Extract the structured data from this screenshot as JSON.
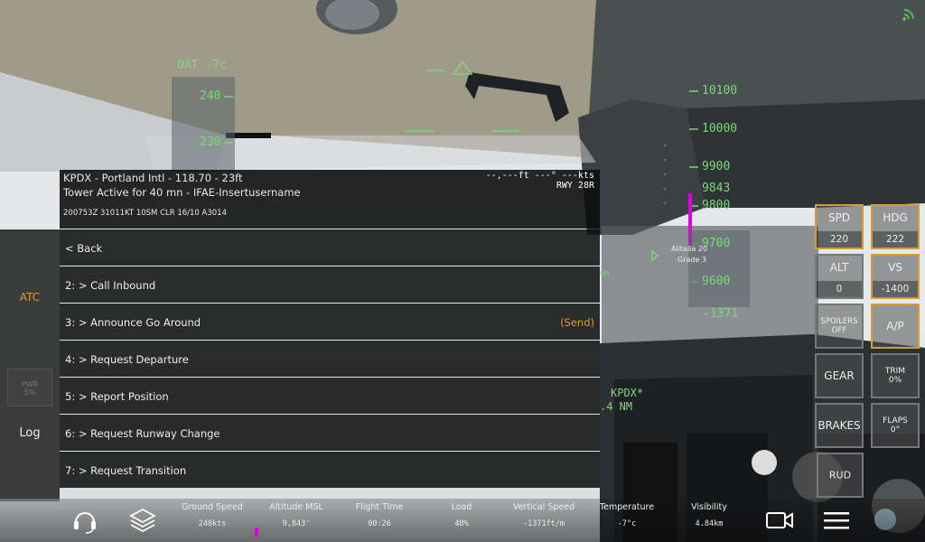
{
  "hud": {
    "oat": "OAT -7c",
    "speed_ticks": [
      "240",
      "230"
    ],
    "alt_ticks": [
      "10100",
      "10000",
      "9900",
      "9800",
      "9700",
      "9600"
    ],
    "current_alt": "9843",
    "vs_readout": "-1371",
    "airport_marker": "KPDX*",
    "nm": ".4 NM",
    "aircraft_label1": "Alitalia 20",
    "aircraft_label2": "Grade 3",
    "on_label": "on"
  },
  "atc": {
    "header": {
      "line1": "KPDX - Portland Intl - 118.70 - 23ft",
      "line2": "Tower Active for 40 mn - IFAE-Insertusername",
      "line3": "200753Z 31011KT 10SM CLR 16/10 A3014",
      "right1": "--,---ft  ---°  ---kts",
      "right2": "RWY 28R"
    },
    "items": [
      {
        "label": "< Back",
        "send": ""
      },
      {
        "label": "2: > Call Inbound",
        "send": ""
      },
      {
        "label": "3: > Announce Go Around",
        "send": "(Send)"
      },
      {
        "label": "4: > Request Departure",
        "send": ""
      },
      {
        "label": "5: > Report Position",
        "send": ""
      },
      {
        "label": "6: > Request Runway Change",
        "send": ""
      },
      {
        "label": "7: > Request Transition",
        "send": ""
      }
    ]
  },
  "side": {
    "atc_tab": "ATC",
    "log_tab": "Log",
    "pwr_label1": "PWR",
    "pwr_label2": "5%"
  },
  "controls": {
    "spd": {
      "label": "SPD",
      "value": "220"
    },
    "hdg": {
      "label": "HDG",
      "value": "222"
    },
    "alt": {
      "label": "ALT",
      "value": "0"
    },
    "vs": {
      "label": "VS",
      "value": "-1400"
    },
    "spoilers": {
      "label1": "SPOILERS",
      "label2": "OFF"
    },
    "ap": {
      "label": "A/P"
    },
    "gear": {
      "label": "GEAR"
    },
    "trim": {
      "label": "TRIM",
      "value": "0%"
    },
    "brakes": {
      "label": "BRAKES"
    },
    "flaps": {
      "label": "FLAPS",
      "value": "0°"
    },
    "rud": {
      "label": "RUD"
    }
  },
  "stats": [
    {
      "title": "Ground Speed",
      "value": "240kts"
    },
    {
      "title": "Altitude MSL",
      "value": "9,843'"
    },
    {
      "title": "Flight Time",
      "value": "00:26"
    },
    {
      "title": "Load",
      "value": "48%"
    },
    {
      "title": "Vertical Speed",
      "value": "-1371ft/m"
    },
    {
      "title": "Temperature",
      "value": "-7°c"
    },
    {
      "title": "Visibility",
      "value": "4.84km"
    }
  ],
  "colors": {
    "accent": "#e39a2c",
    "hud_green": "#7ed67e",
    "vs_bar": "#e000e0"
  },
  "icons": [
    "headset-icon",
    "layers-icon",
    "camera-icon",
    "menu-icon",
    "signal-icon"
  ]
}
